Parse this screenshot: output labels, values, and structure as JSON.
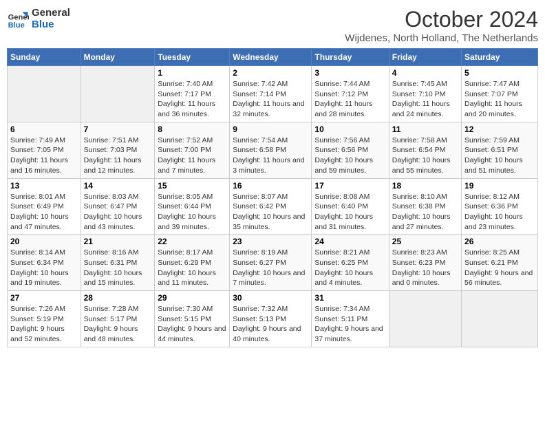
{
  "logo": {
    "line1": "General",
    "line2": "Blue"
  },
  "title": {
    "month_year": "October 2024",
    "location": "Wijdenes, North Holland, The Netherlands"
  },
  "days_of_week": [
    "Sunday",
    "Monday",
    "Tuesday",
    "Wednesday",
    "Thursday",
    "Friday",
    "Saturday"
  ],
  "weeks": [
    [
      {
        "day": "",
        "info": ""
      },
      {
        "day": "",
        "info": ""
      },
      {
        "day": "1",
        "info": "Sunrise: 7:40 AM\nSunset: 7:17 PM\nDaylight: 11 hours and 36 minutes."
      },
      {
        "day": "2",
        "info": "Sunrise: 7:42 AM\nSunset: 7:14 PM\nDaylight: 11 hours and 32 minutes."
      },
      {
        "day": "3",
        "info": "Sunrise: 7:44 AM\nSunset: 7:12 PM\nDaylight: 11 hours and 28 minutes."
      },
      {
        "day": "4",
        "info": "Sunrise: 7:45 AM\nSunset: 7:10 PM\nDaylight: 11 hours and 24 minutes."
      },
      {
        "day": "5",
        "info": "Sunrise: 7:47 AM\nSunset: 7:07 PM\nDaylight: 11 hours and 20 minutes."
      }
    ],
    [
      {
        "day": "6",
        "info": "Sunrise: 7:49 AM\nSunset: 7:05 PM\nDaylight: 11 hours and 16 minutes."
      },
      {
        "day": "7",
        "info": "Sunrise: 7:51 AM\nSunset: 7:03 PM\nDaylight: 11 hours and 12 minutes."
      },
      {
        "day": "8",
        "info": "Sunrise: 7:52 AM\nSunset: 7:00 PM\nDaylight: 11 hours and 7 minutes."
      },
      {
        "day": "9",
        "info": "Sunrise: 7:54 AM\nSunset: 6:58 PM\nDaylight: 11 hours and 3 minutes."
      },
      {
        "day": "10",
        "info": "Sunrise: 7:56 AM\nSunset: 6:56 PM\nDaylight: 10 hours and 59 minutes."
      },
      {
        "day": "11",
        "info": "Sunrise: 7:58 AM\nSunset: 6:54 PM\nDaylight: 10 hours and 55 minutes."
      },
      {
        "day": "12",
        "info": "Sunrise: 7:59 AM\nSunset: 6:51 PM\nDaylight: 10 hours and 51 minutes."
      }
    ],
    [
      {
        "day": "13",
        "info": "Sunrise: 8:01 AM\nSunset: 6:49 PM\nDaylight: 10 hours and 47 minutes."
      },
      {
        "day": "14",
        "info": "Sunrise: 8:03 AM\nSunset: 6:47 PM\nDaylight: 10 hours and 43 minutes."
      },
      {
        "day": "15",
        "info": "Sunrise: 8:05 AM\nSunset: 6:44 PM\nDaylight: 10 hours and 39 minutes."
      },
      {
        "day": "16",
        "info": "Sunrise: 8:07 AM\nSunset: 6:42 PM\nDaylight: 10 hours and 35 minutes."
      },
      {
        "day": "17",
        "info": "Sunrise: 8:08 AM\nSunset: 6:40 PM\nDaylight: 10 hours and 31 minutes."
      },
      {
        "day": "18",
        "info": "Sunrise: 8:10 AM\nSunset: 6:38 PM\nDaylight: 10 hours and 27 minutes."
      },
      {
        "day": "19",
        "info": "Sunrise: 8:12 AM\nSunset: 6:36 PM\nDaylight: 10 hours and 23 minutes."
      }
    ],
    [
      {
        "day": "20",
        "info": "Sunrise: 8:14 AM\nSunset: 6:34 PM\nDaylight: 10 hours and 19 minutes."
      },
      {
        "day": "21",
        "info": "Sunrise: 8:16 AM\nSunset: 6:31 PM\nDaylight: 10 hours and 15 minutes."
      },
      {
        "day": "22",
        "info": "Sunrise: 8:17 AM\nSunset: 6:29 PM\nDaylight: 10 hours and 11 minutes."
      },
      {
        "day": "23",
        "info": "Sunrise: 8:19 AM\nSunset: 6:27 PM\nDaylight: 10 hours and 7 minutes."
      },
      {
        "day": "24",
        "info": "Sunrise: 8:21 AM\nSunset: 6:25 PM\nDaylight: 10 hours and 4 minutes."
      },
      {
        "day": "25",
        "info": "Sunrise: 8:23 AM\nSunset: 6:23 PM\nDaylight: 10 hours and 0 minutes."
      },
      {
        "day": "26",
        "info": "Sunrise: 8:25 AM\nSunset: 6:21 PM\nDaylight: 9 hours and 56 minutes."
      }
    ],
    [
      {
        "day": "27",
        "info": "Sunrise: 7:26 AM\nSunset: 5:19 PM\nDaylight: 9 hours and 52 minutes."
      },
      {
        "day": "28",
        "info": "Sunrise: 7:28 AM\nSunset: 5:17 PM\nDaylight: 9 hours and 48 minutes."
      },
      {
        "day": "29",
        "info": "Sunrise: 7:30 AM\nSunset: 5:15 PM\nDaylight: 9 hours and 44 minutes."
      },
      {
        "day": "30",
        "info": "Sunrise: 7:32 AM\nSunset: 5:13 PM\nDaylight: 9 hours and 40 minutes."
      },
      {
        "day": "31",
        "info": "Sunrise: 7:34 AM\nSunset: 5:11 PM\nDaylight: 9 hours and 37 minutes."
      },
      {
        "day": "",
        "info": ""
      },
      {
        "day": "",
        "info": ""
      }
    ]
  ]
}
